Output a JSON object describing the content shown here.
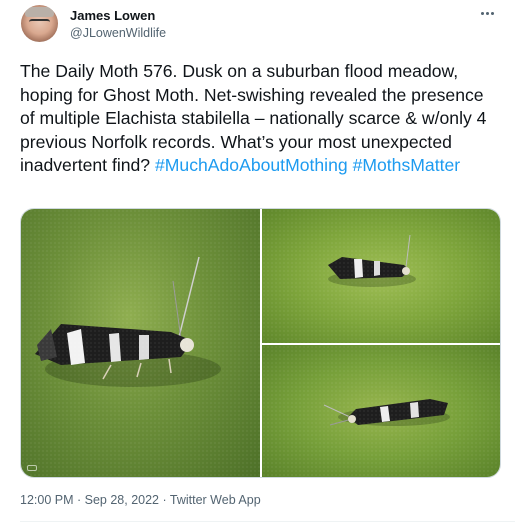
{
  "author": {
    "display_name": "James Lowen",
    "handle": "@JLowenWildlife",
    "avatar_icon": "avatar-photo"
  },
  "tweet": {
    "text": "The Daily Moth 576. Dusk on a suburban flood meadow, hoping for Ghost Moth. Net-swishing revealed the presence of multiple Elachista stabilella – nationally scarce & w/only 4 previous Norfolk records. What’s your most unexpected inadvertent find?",
    "hashtags": [
      "#MuchAdoAboutMothing",
      "#MothsMatter"
    ],
    "link_color": "#1d9bf0"
  },
  "media": {
    "photos": [
      {
        "icon": "moth-photo-large"
      },
      {
        "icon": "moth-photo-top-right"
      },
      {
        "icon": "moth-photo-bottom-right"
      }
    ]
  },
  "meta": {
    "time": "12:00 PM",
    "separator": " · ",
    "date": "Sep 28, 2022",
    "source": "Twitter Web App"
  },
  "more_icon": "more-horizontal-icon"
}
